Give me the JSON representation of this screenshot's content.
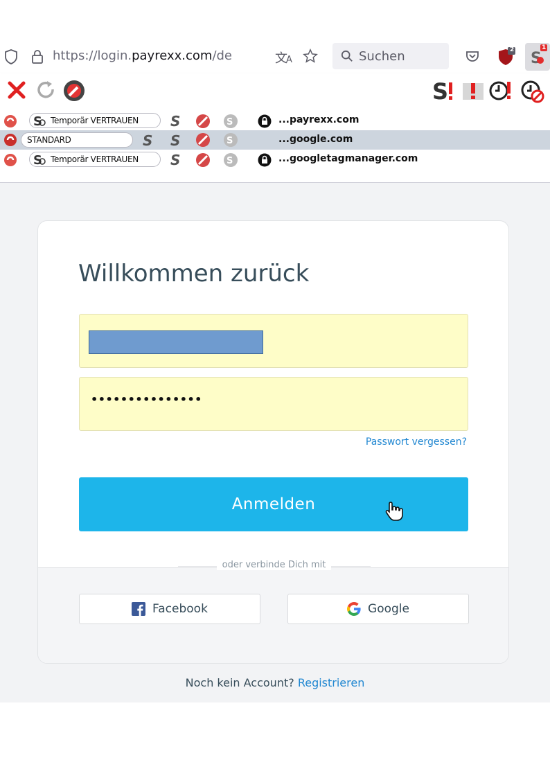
{
  "browser": {
    "url_prefix": "https://login.",
    "url_domain": "payrexx.com",
    "url_suffix": "/de",
    "search_placeholder": "Suchen",
    "badge_count_1": "2",
    "badge_count_2": "1"
  },
  "noscript": {
    "rows": [
      {
        "pill_label": "Temporär VERTRAUEN",
        "domain": "...payrexx.com",
        "selected": false
      },
      {
        "pill_label": "STANDARD",
        "domain": "...google.com",
        "selected": true
      },
      {
        "pill_label": "Temporär VERTRAUEN",
        "domain": "...googletagmanager.com",
        "selected": false
      }
    ]
  },
  "login": {
    "title": "Willkommen zurück",
    "password_mask": "•••••••••••••••",
    "forgot_label": "Passwort vergessen?",
    "submit_label": "Anmelden",
    "divider_label": "oder verbinde Dich mit",
    "facebook_label": "Facebook",
    "google_label": "Google",
    "no_account_text": "Noch kein Account?",
    "register_label": "Registrieren"
  },
  "colors": {
    "accent_button": "#1db5ea",
    "link": "#2187d1",
    "autofill_bg": "#fefdc8",
    "title_text": "#374d5a"
  }
}
